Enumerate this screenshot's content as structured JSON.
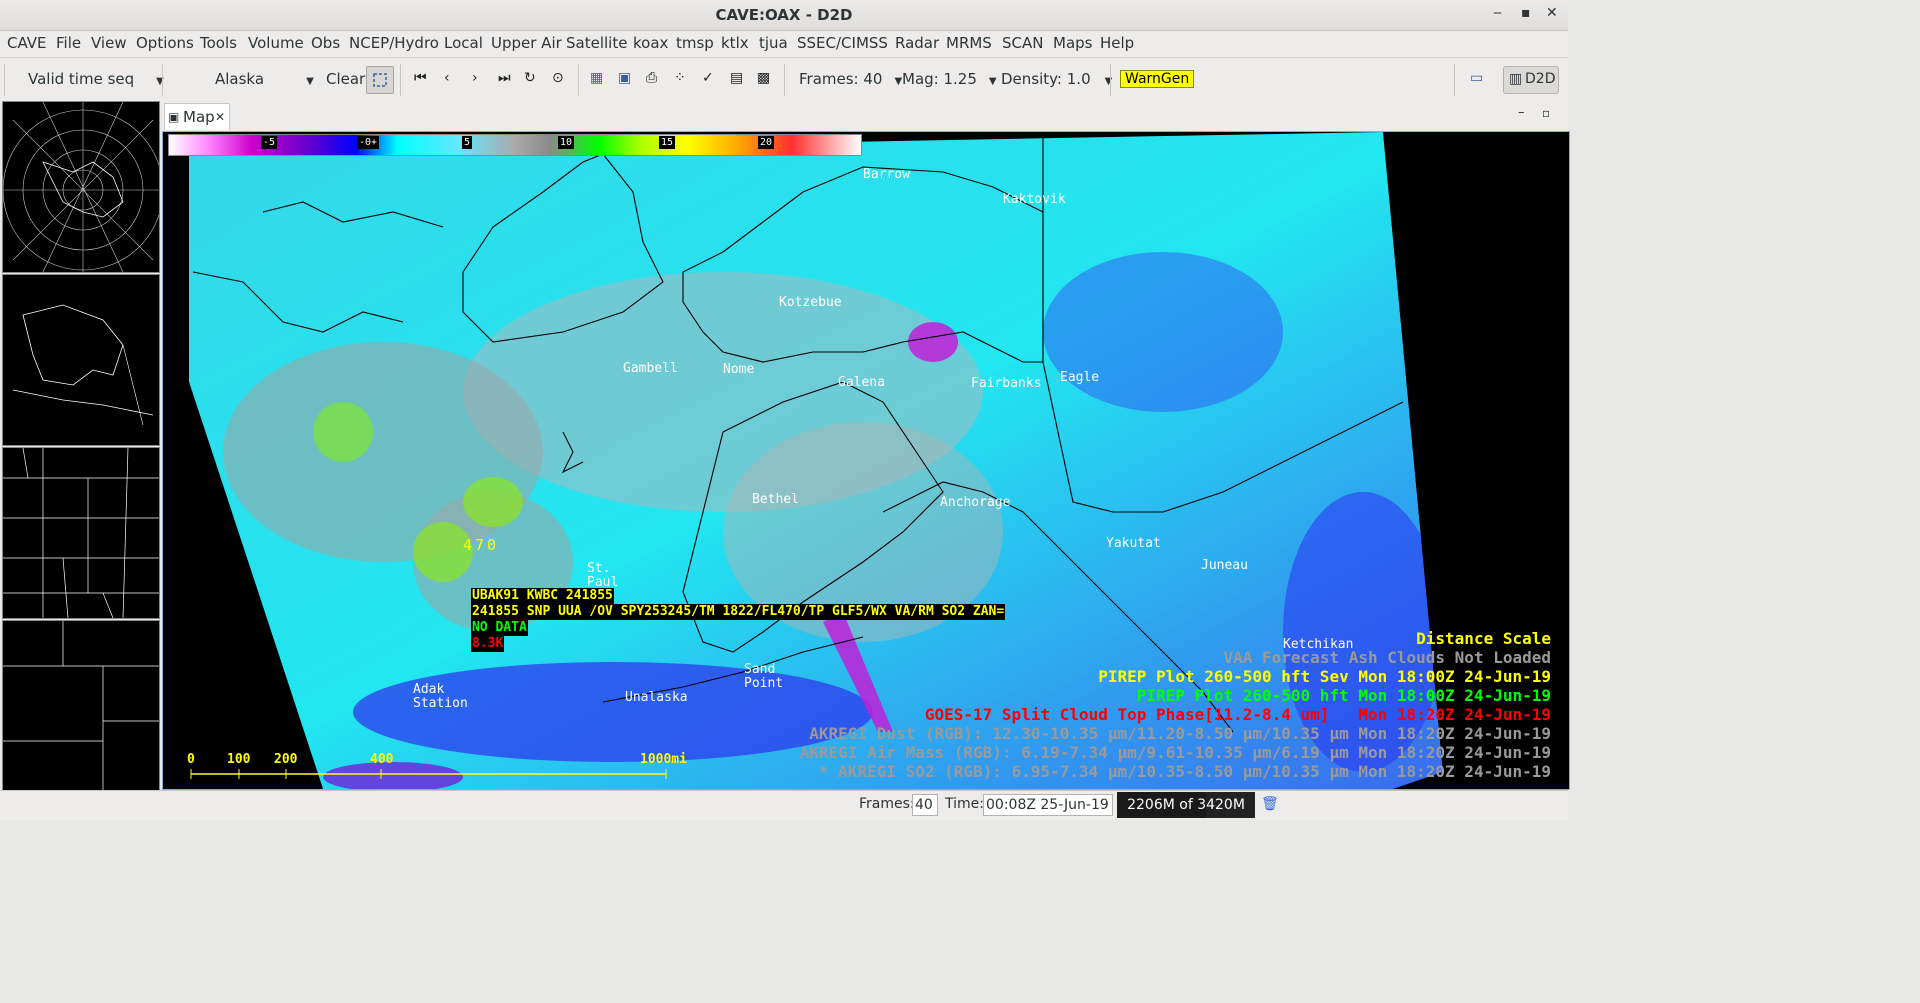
{
  "window": {
    "title": "CAVE:OAX - D2D",
    "minimize": "▪",
    "maximize": "▪",
    "close": "✕"
  },
  "menu": [
    "CAVE",
    "File",
    "View",
    "Options",
    "Tools",
    "Volume",
    "Obs",
    "NCEP/Hydro",
    "Local",
    "Upper Air",
    "Satellite",
    "koax",
    "tmsp",
    "ktlx",
    "tjua",
    "SSEC/CIMSS",
    "Radar",
    "MRMS",
    "SCAN",
    "Maps",
    "Help"
  ],
  "toolbar": {
    "time_mode": "Valid time seq",
    "scale": "Alaska",
    "clear": "Clear",
    "frames": "Frames: 40",
    "mag": "Mag: 1.25",
    "density": "Density: 1.0",
    "warngen": "WarnGen",
    "perspective": "D2D"
  },
  "map_tab": {
    "label": "Map"
  },
  "colorbar": {
    "ticks": [
      "-5",
      "-0+",
      "5",
      "10",
      "15",
      "20"
    ]
  },
  "cities": [
    "Barrow",
    "Kaktovik",
    "Kotzebue",
    "Gambell",
    "Nome",
    "Galena",
    "Fairbanks",
    "Eagle",
    "Bethel",
    "Anchorage",
    "Yakutat",
    "Juneau",
    "St.\nPaul",
    "Sand\nPoint",
    "Unalaska",
    "Adak\nStation",
    "Ketchikan"
  ],
  "pirep": {
    "line1": "UBAK91 KWBC 241855",
    "line2": "241855 SNP UUA /OV SPY253245/TM 1822/FL470/TP GLF5/WX VA/RM SO2 ZAN=",
    "line3": "NO DATA",
    "line4": "8.3K",
    "marker": "470"
  },
  "scale": {
    "ticks": [
      "0",
      "100",
      "200",
      "400",
      "1000mi"
    ]
  },
  "legend": [
    {
      "text": "Distance Scale",
      "color": "#ffff00"
    },
    {
      "text": "VAA Forecast Ash Clouds Not Loaded",
      "color": "#9a9a9a"
    },
    {
      "text": "PIREP Plot 260-500 hft Sev Mon 18:00Z 24-Jun-19",
      "color": "#ffff00"
    },
    {
      "text": "PIREP Plot 260-500 hft Mon 18:00Z 24-Jun-19",
      "color": "#00ff00"
    },
    {
      "text": "GOES-17 Split Cloud Top Phase[11.2-8.4 um]   Mon 18:20Z 24-Jun-19",
      "color": "#ff0000"
    },
    {
      "text": "AKREGI Dust (RGB): 12.30-10.35 µm/11.20-8.50 µm/10.35 µm Mon 18:20Z 24-Jun-19",
      "color": "#9a9a9a"
    },
    {
      "text": "AKREGI Air Mass (RGB): 6.19-7.34 µm/9.61-10.35 µm/6.19 µm Mon 18:20Z 24-Jun-19",
      "color": "#9a9a9a"
    },
    {
      "text": "* AKREGI SO2 (RGB): 6.95-7.34 µm/10.35-8.50 µm/10.35 µm Mon 18:20Z 24-Jun-19",
      "color": "#9a9a9a"
    }
  ],
  "status": {
    "frames_label": "Frames:",
    "frames_value": "40",
    "time_label": "Time:",
    "time_value": "00:08Z 25-Jun-19",
    "memory": "2206M of 3420M",
    "memory_fraction": 0.645
  }
}
